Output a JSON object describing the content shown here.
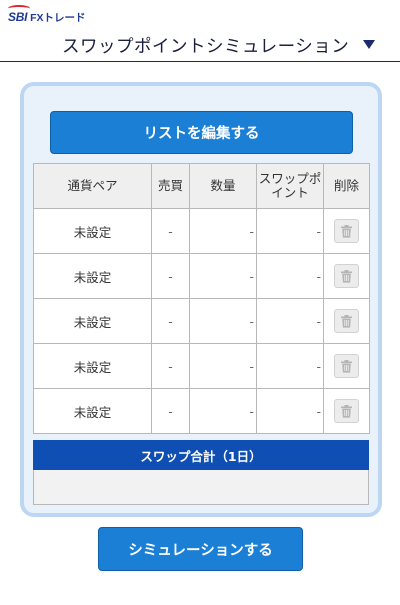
{
  "header": {
    "logo_sbi": "SBI",
    "logo_fx": "FXトレード",
    "title": "スワップポイントシミュレーション",
    "menu_icon": "triangle-down-icon"
  },
  "panel": {
    "edit_button_label": "リストを編集する",
    "table": {
      "columns": [
        "通貨ペア",
        "売買",
        "数量",
        "スワップポイント",
        "削除"
      ],
      "rows": [
        {
          "pair": "未設定",
          "side": "-",
          "quantity": "-",
          "swap": "-",
          "delete_icon": "trash-icon"
        },
        {
          "pair": "未設定",
          "side": "-",
          "quantity": "-",
          "swap": "-",
          "delete_icon": "trash-icon"
        },
        {
          "pair": "未設定",
          "side": "-",
          "quantity": "-",
          "swap": "-",
          "delete_icon": "trash-icon"
        },
        {
          "pair": "未設定",
          "side": "-",
          "quantity": "-",
          "swap": "-",
          "delete_icon": "trash-icon"
        },
        {
          "pair": "未設定",
          "side": "-",
          "quantity": "-",
          "swap": "-",
          "delete_icon": "trash-icon"
        }
      ]
    },
    "summary": {
      "title": "スワップ合計（1日）",
      "value": ""
    }
  },
  "simulate_button_label": "シミュレーションする",
  "colors": {
    "primary_button": "#1b7fd6",
    "summary_header": "#0f4fb3",
    "panel_bg": "#e9f1fb",
    "panel_border": "#bcd6f3",
    "title_text": "#1a1f3c"
  }
}
